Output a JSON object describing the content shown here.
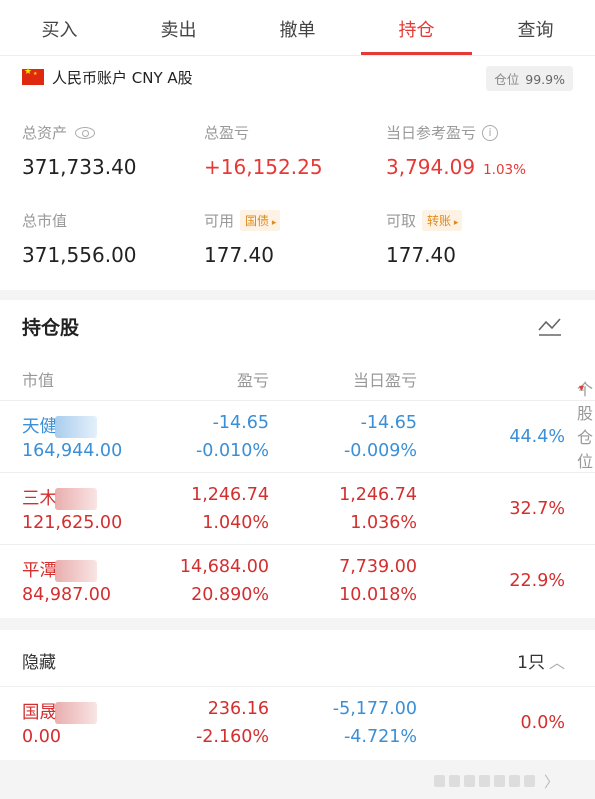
{
  "tabs": [
    {
      "label": "买入"
    },
    {
      "label": "卖出"
    },
    {
      "label": "撤单"
    },
    {
      "label": "持仓"
    },
    {
      "label": "查询"
    }
  ],
  "active_tab_index": 3,
  "account": {
    "name": "人民币账户 CNY A股",
    "position_label": "仓位",
    "position_value": "99.9%"
  },
  "summary": {
    "total_assets_label": "总资产",
    "total_assets": "371,733.40",
    "total_pnl_label": "总盈亏",
    "total_pnl": "+16,152.25",
    "day_pnl_label": "当日参考盈亏",
    "day_pnl": "3,794.09",
    "day_pnl_pct": "1.03%",
    "market_value_label": "总市值",
    "market_value": "371,556.00",
    "available_label": "可用",
    "available_tag": "国债",
    "available": "177.40",
    "withdrawable_label": "可取",
    "withdrawable_tag": "转账",
    "withdrawable": "177.40"
  },
  "holdings": {
    "title": "持仓股",
    "columns": [
      "市值",
      "盈亏",
      "当日盈亏",
      "个股仓位"
    ],
    "rows": [
      {
        "name": "天健",
        "market_value": "164,944.00",
        "pnl": "-14.65",
        "pnl_pct": "-0.010%",
        "day_pnl": "-14.65",
        "day_pnl_pct": "-0.009%",
        "weight": "44.4%",
        "tone": "down"
      },
      {
        "name": "三木",
        "market_value": "121,625.00",
        "pnl": "1,246.74",
        "pnl_pct": "1.040%",
        "day_pnl": "1,246.74",
        "day_pnl_pct": "1.036%",
        "weight": "32.7%",
        "tone": "up"
      },
      {
        "name": "平潭",
        "market_value": "84,987.00",
        "pnl": "14,684.00",
        "pnl_pct": "20.890%",
        "day_pnl": "7,739.00",
        "day_pnl_pct": "10.018%",
        "weight": "22.9%",
        "tone": "up"
      }
    ]
  },
  "hidden": {
    "title": "隐藏",
    "count": "1只",
    "rows": [
      {
        "name": "国晟",
        "market_value": "0.00",
        "pnl": "236.16",
        "pnl_pct": "-2.160%",
        "day_pnl": "-5,177.00",
        "day_pnl_pct": "-4.721%",
        "weight": "0.0%"
      }
    ]
  },
  "colors": {
    "accent": "#e53935",
    "down": "#3b8fd6",
    "up": "#d32f2f"
  }
}
